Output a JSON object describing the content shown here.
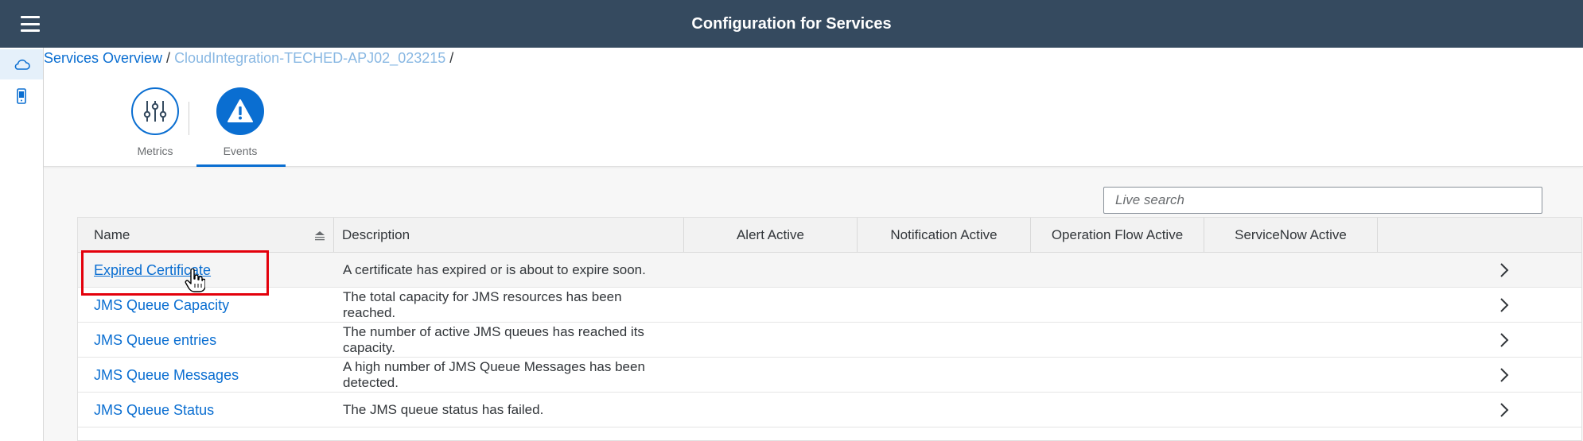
{
  "header": {
    "title": "Configuration for Services"
  },
  "breadcrumb": {
    "root": "Services Overview",
    "separator": " / ",
    "current": "CloudIntegration-TECHED-APJ02_023215",
    "trailing": " /"
  },
  "tabs": [
    {
      "label": "Metrics",
      "icon": "metrics-sliders-icon"
    },
    {
      "label": "Events",
      "icon": "alert-icon",
      "selected": true
    }
  ],
  "search": {
    "placeholder": "Live search",
    "value": ""
  },
  "table": {
    "columns": [
      "Name",
      "Description",
      "Alert Active",
      "Notification Active",
      "Operation Flow Active",
      "ServiceNow Active"
    ],
    "rows": [
      {
        "name": "Expired Certificate",
        "description": "A certificate has expired or is about to expire soon."
      },
      {
        "name": "JMS Queue Capacity",
        "description": "The total capacity for JMS resources has been reached."
      },
      {
        "name": "JMS Queue entries",
        "description": "The number of active JMS queues has reached its capacity."
      },
      {
        "name": "JMS Queue Messages",
        "description": "A high number of JMS Queue Messages has been detected."
      },
      {
        "name": "JMS Queue Status",
        "description": "The JMS queue status has failed."
      }
    ]
  },
  "colors": {
    "shell": "#354a5f",
    "accent": "#0a6ed1",
    "highlight": "#e3000b"
  }
}
